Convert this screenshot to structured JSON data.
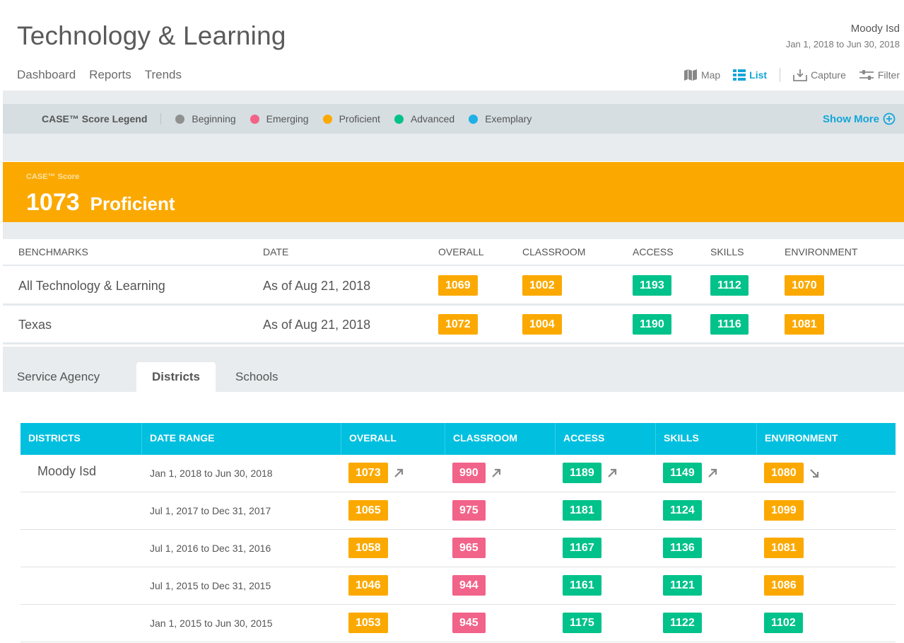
{
  "header": {
    "title": "Technology & Learning",
    "org_name": "Moody Isd",
    "org_range": "Jan 1, 2018 to Jun 30, 2018"
  },
  "nav": [
    "Dashboard",
    "Reports",
    "Trends"
  ],
  "tools": {
    "map": "Map",
    "list": "List",
    "capture": "Capture",
    "filter": "Filter"
  },
  "legend": {
    "title": "CASE™ Score Legend",
    "items": [
      {
        "label": "Beginning",
        "color": "#909090"
      },
      {
        "label": "Emerging",
        "color": "#f26389"
      },
      {
        "label": "Proficient",
        "color": "#fba900"
      },
      {
        "label": "Advanced",
        "color": "#00c28a"
      },
      {
        "label": "Exemplary",
        "color": "#1fb0e6"
      }
    ],
    "show_more": "Show More"
  },
  "score": {
    "caption": "CASE™ Score",
    "value": "1073",
    "level": "Proficient"
  },
  "benchmarks": {
    "headers": [
      "BENCHMARKS",
      "DATE",
      "OVERALL",
      "CLASSROOM",
      "ACCESS",
      "SKILLS",
      "ENVIRONMENT"
    ],
    "rows": [
      {
        "name": "All Technology & Learning",
        "date": "As of Aug 21, 2018",
        "scores": [
          [
            "1069",
            "prof"
          ],
          [
            "1002",
            "prof"
          ],
          [
            "1193",
            "adv"
          ],
          [
            "1112",
            "adv"
          ],
          [
            "1070",
            "prof"
          ]
        ]
      },
      {
        "name": "Texas",
        "date": "As of Aug 21, 2018",
        "scores": [
          [
            "1072",
            "prof"
          ],
          [
            "1004",
            "prof"
          ],
          [
            "1190",
            "adv"
          ],
          [
            "1116",
            "adv"
          ],
          [
            "1081",
            "prof"
          ]
        ]
      }
    ]
  },
  "tabs": [
    {
      "label": "Service Agency",
      "active": false
    },
    {
      "label": "Districts",
      "active": true
    },
    {
      "label": "Schools",
      "active": false
    }
  ],
  "districts": {
    "headers": [
      "DISTRICTS",
      "DATE RANGE",
      "OVERALL",
      "CLASSROOM",
      "ACCESS",
      "SKILLS",
      "ENVIRONMENT"
    ],
    "rows": [
      {
        "name": "Moody Isd",
        "range": "Jan 1, 2018 to Jun 30, 2018",
        "scores": [
          [
            "1073",
            "prof",
            "up"
          ],
          [
            "990",
            "emer",
            "up"
          ],
          [
            "1189",
            "adv",
            "up"
          ],
          [
            "1149",
            "adv",
            "up"
          ],
          [
            "1080",
            "prof",
            "down"
          ]
        ]
      },
      {
        "name": "",
        "range": "Jul 1, 2017 to Dec 31, 2017",
        "scores": [
          [
            "1065",
            "prof",
            ""
          ],
          [
            "975",
            "emer",
            ""
          ],
          [
            "1181",
            "adv",
            ""
          ],
          [
            "1124",
            "adv",
            ""
          ],
          [
            "1099",
            "prof",
            ""
          ]
        ]
      },
      {
        "name": "",
        "range": "Jul 1, 2016 to Dec 31, 2016",
        "scores": [
          [
            "1058",
            "prof",
            ""
          ],
          [
            "965",
            "emer",
            ""
          ],
          [
            "1167",
            "adv",
            ""
          ],
          [
            "1136",
            "adv",
            ""
          ],
          [
            "1081",
            "prof",
            ""
          ]
        ]
      },
      {
        "name": "",
        "range": "Jul 1, 2015 to Dec 31, 2015",
        "scores": [
          [
            "1046",
            "prof",
            ""
          ],
          [
            "944",
            "emer",
            ""
          ],
          [
            "1161",
            "adv",
            ""
          ],
          [
            "1121",
            "adv",
            ""
          ],
          [
            "1086",
            "prof",
            ""
          ]
        ]
      },
      {
        "name": "",
        "range": "Jan 1, 2015 to Jun 30, 2015",
        "scores": [
          [
            "1053",
            "prof",
            ""
          ],
          [
            "945",
            "emer",
            ""
          ],
          [
            "1175",
            "adv",
            ""
          ],
          [
            "1122",
            "adv",
            ""
          ],
          [
            "1102",
            "adv",
            ""
          ]
        ]
      }
    ]
  }
}
